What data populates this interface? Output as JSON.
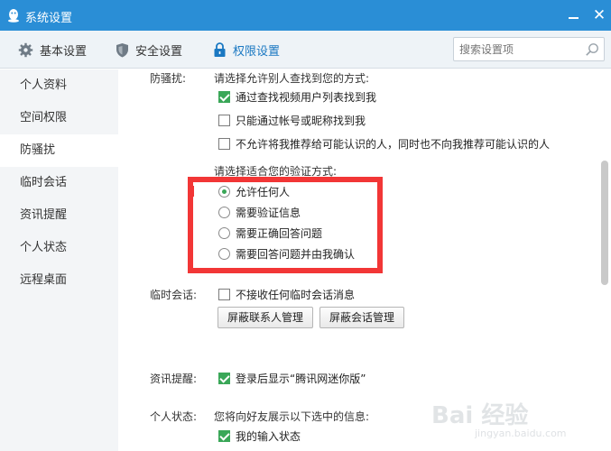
{
  "window": {
    "title": "系统设置"
  },
  "tabs": [
    {
      "label": "基本设置",
      "icon": "gear-icon"
    },
    {
      "label": "安全设置",
      "icon": "shield-icon"
    },
    {
      "label": "权限设置",
      "icon": "lock-icon",
      "active": true
    }
  ],
  "search": {
    "placeholder": "搜索设置项"
  },
  "sidebar": {
    "items": [
      {
        "label": "个人资料"
      },
      {
        "label": "空间权限"
      },
      {
        "label": "防骚扰",
        "active": true
      },
      {
        "label": "临时会话"
      },
      {
        "label": "资讯提醒"
      },
      {
        "label": "个人状态"
      },
      {
        "label": "远程桌面"
      }
    ]
  },
  "anti_harass": {
    "label": "防骚扰:",
    "find_prompt": "请选择允许别人查找到您的方式:",
    "find_options": [
      {
        "label": "通过查找视频用户列表找到我",
        "checked": true
      },
      {
        "label": "只能通过帐号或昵称找到我",
        "checked": false
      },
      {
        "label": "不允许将我推荐给可能认识的人，同时也不向我推荐可能认识的人",
        "checked": false
      }
    ],
    "verify_prompt": "请选择适合您的验证方式:",
    "verify_options": [
      {
        "label": "允许任何人",
        "selected": true
      },
      {
        "label": "需要验证信息",
        "selected": false
      },
      {
        "label": "需要正确回答问题",
        "selected": false
      },
      {
        "label": "需要回答问题并由我确认",
        "selected": false
      }
    ]
  },
  "temp_chat": {
    "label": "临时会话:",
    "option": {
      "label": "不接收任何临时会话消息",
      "checked": false
    },
    "buttons": {
      "contacts": "屏蔽联系人管理",
      "sessions": "屏蔽会话管理"
    }
  },
  "news": {
    "label": "资讯提醒:",
    "option": {
      "label": "登录后显示“腾讯网迷你版”",
      "checked": true
    }
  },
  "status": {
    "label": "个人状态:",
    "prompt": "您将向好友展示以下选中的信息:",
    "option": {
      "label": "我的输入状态",
      "checked": true
    }
  },
  "watermark": {
    "text": "Bai 经验",
    "sub": "jingyan.baidu.com"
  },
  "colors": {
    "titlebar": "#2a8ed6",
    "accent": "#1a78c2",
    "check": "#3aa758",
    "highlight": "#f23636"
  }
}
